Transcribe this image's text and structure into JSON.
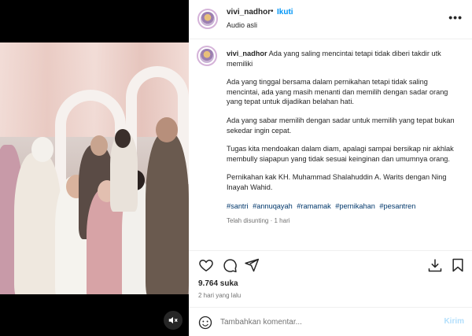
{
  "post": {
    "username": "vivi_nadhor",
    "follow_label": "Ikuti",
    "audio_label": "Audio asli",
    "caption": {
      "first_line": "Ada yang saling mencintai tetapi tidak diberi takdir utk memiliki",
      "paragraphs": [
        "Ada yang tinggal bersama dalam pernikahan tetapi tidak saling mencintai, ada yang masih menanti dan memilih dengan sadar orang yang tepat untuk dijadikan belahan hati.",
        "Ada yang sabar memilih dengan sadar untuk memilih yang tepat bukan sekedar ingin cepat.",
        "Tugas kita mendoakan dalam diam, apalagi sampai bersikap nir akhlak membully siapapun yang tidak sesuai keinginan dan umumnya orang.",
        "Pernikahan kak KH. Muhammad Shalahuddin A. Warits dengan Ning Inayah Wahid."
      ],
      "hashtags": [
        "#santri",
        "#annuqayah",
        "#ramamak",
        "#pernikahan",
        "#pesantren"
      ],
      "edited_label": "Telah disunting",
      "edited_time": "1 hari"
    },
    "likes": "9.764 suka",
    "posted_time": "2 hari yang lalu",
    "comment_placeholder": "Tambahkan komentar...",
    "send_label": "Kirim"
  },
  "icons": {
    "more": "more-options-icon",
    "like": "heart-icon",
    "comment": "comment-icon",
    "share": "send-icon",
    "download": "download-icon",
    "save": "bookmark-icon",
    "emoji": "emoji-icon",
    "mute": "audio-muted-icon"
  },
  "colors": {
    "link": "#0095f6",
    "hashtag": "#00376b",
    "muted_text": "#737373",
    "send_disabled": "#b2dffc"
  }
}
